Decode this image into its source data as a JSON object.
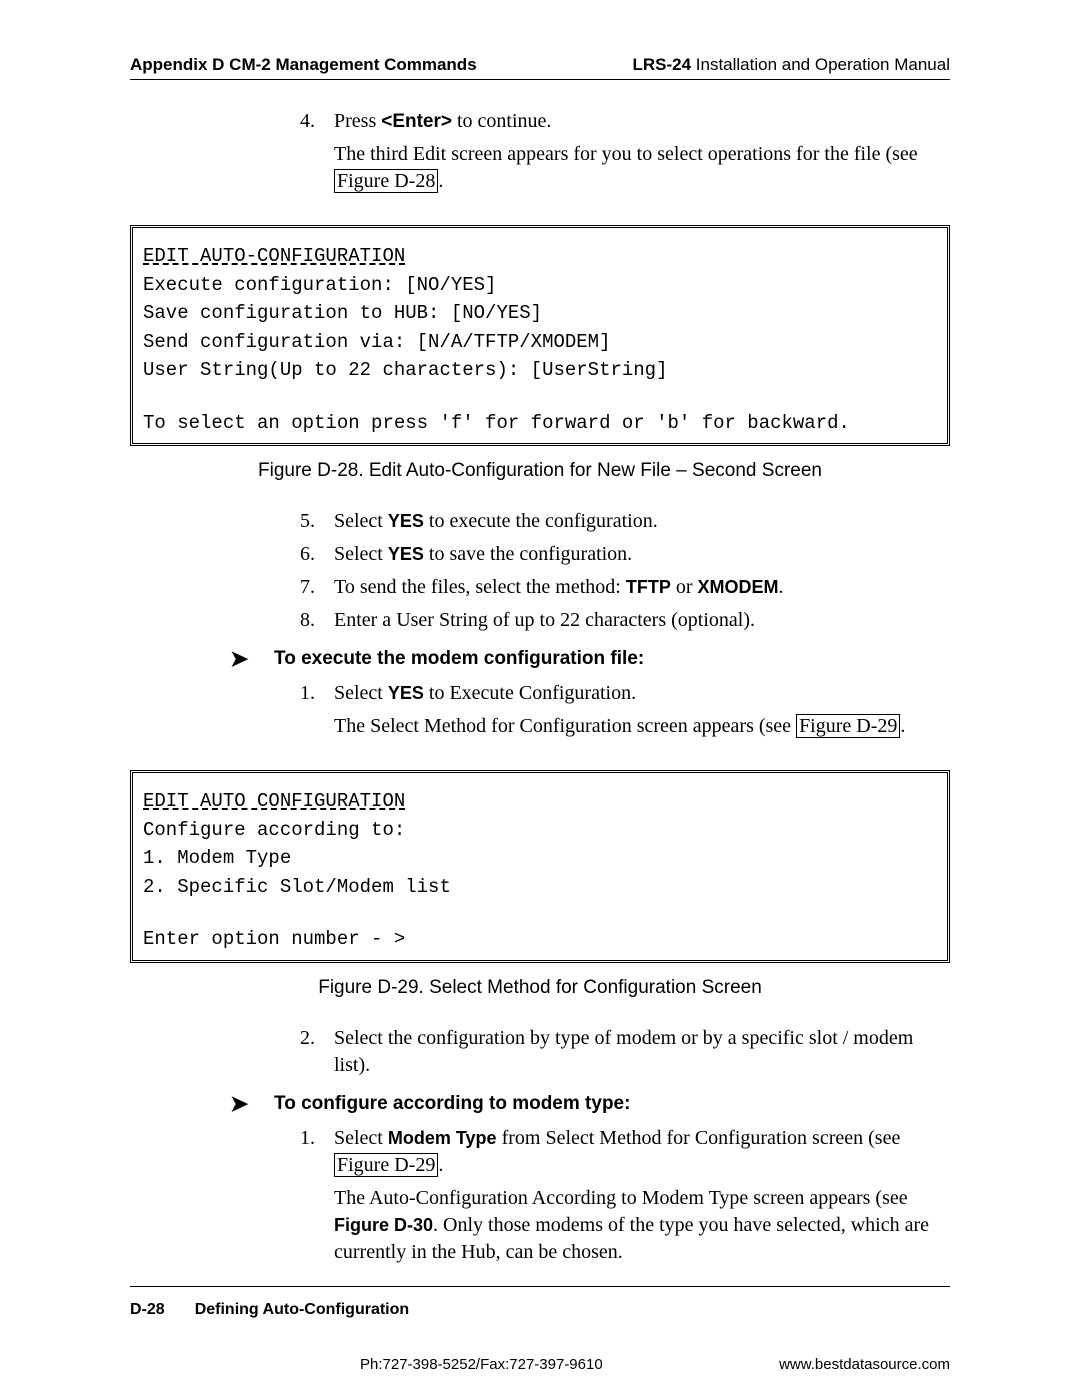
{
  "header": {
    "left": "Appendix D  CM-2 Management Commands",
    "right_bold": "LRS-24",
    "right_rest": " Installation and Operation Manual"
  },
  "step4": {
    "num": "4.",
    "pre": "Press ",
    "enter": "<Enter>",
    "post": "  to continue."
  },
  "step4_result": {
    "text": "The third Edit screen appears for you to select operations for the file (see ",
    "figref": "Figure D-28",
    "tail": "."
  },
  "codebox1": {
    "title": "EDIT AUTO-CONFIGURATION",
    "l1": "Execute configuration: [NO/YES]",
    "l2": "Save configuration to HUB: [NO/YES]",
    "l3": "Send configuration via: [N/A/TFTP/XMODEM]",
    "l4": "User String(Up to 22 characters): [UserString]",
    "l5": "To select an option press 'f' for forward or 'b' for backward."
  },
  "cap1": "Figure D-28.  Edit Auto-Configuration for New File – Second Screen",
  "steps_a": {
    "s5": {
      "num": "5.",
      "pre": "Select ",
      "bold": "YES",
      "post": " to execute the configuration."
    },
    "s6": {
      "num": "6.",
      "pre": "Select ",
      "bold": "YES",
      "post": " to save the configuration."
    },
    "s7": {
      "num": "7.",
      "pre": "To send the files, select the method: ",
      "bold1": "TFTP",
      "mid": " or ",
      "bold2": "XMODEM",
      "post": "."
    },
    "s8": {
      "num": "8.",
      "text": "Enter a User String of up to 22 characters (optional)."
    }
  },
  "proc1": "To execute the modem configuration file:",
  "proc1_s1": {
    "num": "1.",
    "pre": "Select ",
    "bold": "YES",
    "post": " to Execute Configuration."
  },
  "proc1_r": {
    "pre": "The Select Method for Configuration screen appears (see ",
    "figref": "Figure D-29",
    "post": "."
  },
  "codebox2": {
    "title": "EDIT AUTO CONFIGURATION",
    "l1": "Configure according to:",
    "l2": "1. Modem Type",
    "l3": "2. Specific Slot/Modem list",
    "l4": "Enter option number - >"
  },
  "cap2": "Figure D-29.  Select Method for Configuration Screen",
  "step2b": {
    "num": "2.",
    "text": "Select the configuration by type of modem or by a specific slot / modem list)."
  },
  "proc2": "To configure according to modem type:",
  "proc2_s1": {
    "num": "1.",
    "pre": "Select ",
    "bold": "Modem Type",
    "post": " from Select Method for Configuration screen (see "
  },
  "proc2_fig": "Figure D-29",
  "proc2_tail": ".",
  "proc2_r": {
    "pre": "The Auto-Configuration According to Modem Type screen appears (see ",
    "bold": "Figure D-30",
    "post": ". Only those modems of the type you have selected, which are currently in the Hub, can be chosen."
  },
  "footer": {
    "page": "D-28",
    "section": "Defining Auto-Configuration",
    "contact": "Ph:727-398-5252/Fax:727-397-9610",
    "url": "www.bestdatasource.com"
  }
}
